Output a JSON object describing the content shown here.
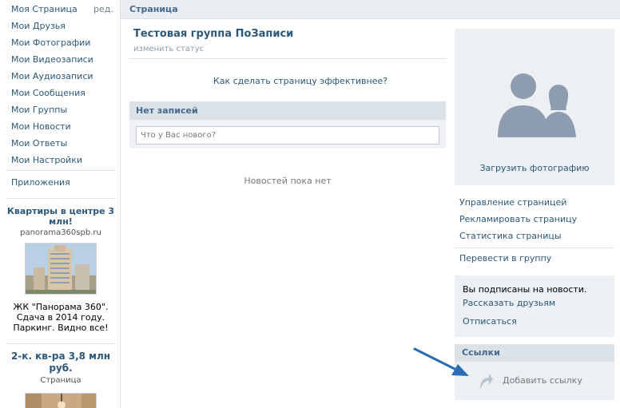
{
  "sidebar": {
    "items": [
      {
        "label": "Моя Страница"
      },
      {
        "label": "Мои Друзья"
      },
      {
        "label": "Мои Фотографии"
      },
      {
        "label": "Мои Видеозаписи"
      },
      {
        "label": "Мои Аудиозаписи"
      },
      {
        "label": "Мои Сообщения"
      },
      {
        "label": "Мои Группы"
      },
      {
        "label": "Мои Новости"
      },
      {
        "label": "Мои Ответы"
      },
      {
        "label": "Мои Настройки"
      }
    ],
    "edit_label": "ред.",
    "apps_label": "Приложения"
  },
  "ads": [
    {
      "title": "Квартиры в центре 3 млн!",
      "domain": "panorama360spb.ru",
      "text": "ЖК \"Панорама 360\". Сдача в 2014 году. Паркинг. Видно все!"
    },
    {
      "title": "2-к. кв-ра 3,8 млн руб.",
      "domain": "Страница"
    }
  ],
  "header": {
    "title": "Страница"
  },
  "main": {
    "group_name": "Тестовая группа ПоЗаписи",
    "status_link": "изменить статус",
    "tips_link": "Как сделать страницу эффективнее?",
    "wall_title": "Нет записей",
    "post_placeholder": "Что у Вас нового?",
    "empty_text": "Новостей пока нет"
  },
  "right": {
    "upload_photo": "Загрузить фотографию",
    "menu": [
      {
        "label": "Управление страницей"
      },
      {
        "label": "Рекламировать страницу"
      },
      {
        "label": "Статистика страницы"
      },
      {
        "label": "Перевести в группу"
      }
    ],
    "subscription": {
      "status": "Вы подписаны на новости.",
      "share": "Рассказать друзьям",
      "unsubscribe": "Отписаться"
    },
    "links": {
      "title": "Ссылки",
      "add_link": "Добавить ссылку"
    }
  },
  "colors": {
    "link": "#2b587a",
    "header_bg": "#eaedf1",
    "block_bg": "#edf0f3",
    "block_header_bg": "#dae2e8",
    "annotation_arrow": "#2a6db3"
  }
}
